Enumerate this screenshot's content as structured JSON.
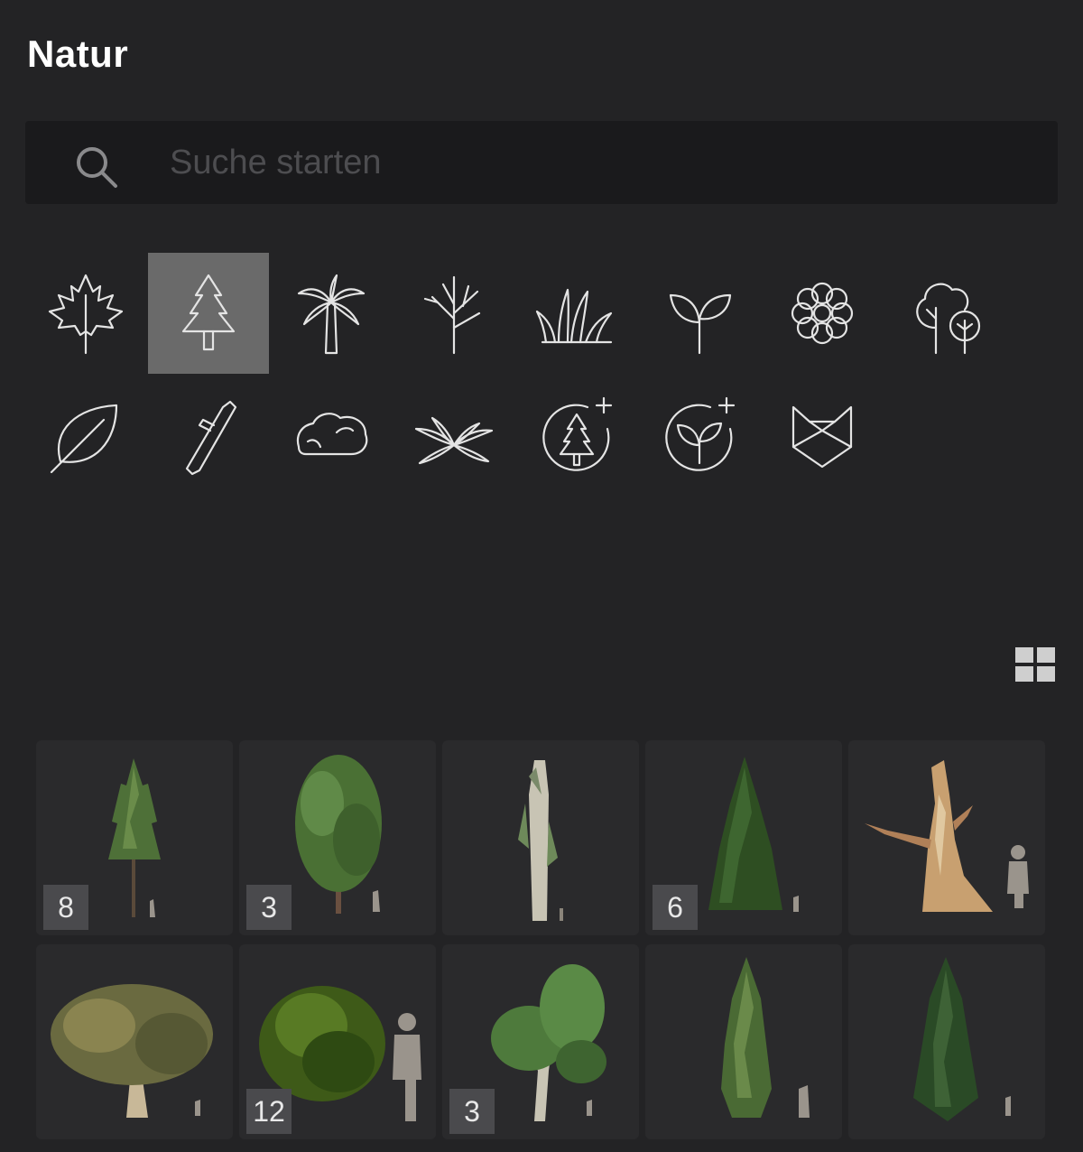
{
  "panel": {
    "title": "Natur"
  },
  "search": {
    "placeholder": "Suche starten",
    "value": ""
  },
  "categories": [
    {
      "icon": "maple-leaf-icon",
      "selected": false
    },
    {
      "icon": "conifer-tree-icon",
      "selected": true
    },
    {
      "icon": "palm-tree-icon",
      "selected": false
    },
    {
      "icon": "bare-tree-icon",
      "selected": false
    },
    {
      "icon": "grass-icon",
      "selected": false
    },
    {
      "icon": "sprout-icon",
      "selected": false
    },
    {
      "icon": "flower-icon",
      "selected": false
    },
    {
      "icon": "tree-group-icon",
      "selected": false
    },
    {
      "icon": "leaf-icon",
      "selected": false
    },
    {
      "icon": "branch-icon",
      "selected": false
    },
    {
      "icon": "rock-icon",
      "selected": false
    },
    {
      "icon": "ground-plants-icon",
      "selected": false
    },
    {
      "icon": "add-tree-icon",
      "selected": false
    },
    {
      "icon": "add-plant-icon",
      "selected": false
    },
    {
      "icon": "fox-icon",
      "selected": false
    }
  ],
  "view_toggle": {
    "icon": "grid-view-icon"
  },
  "assets": [
    {
      "badge": "8",
      "kind": "slim-pine"
    },
    {
      "badge": "3",
      "kind": "leafy-tree"
    },
    {
      "badge": "",
      "kind": "dead-tree"
    },
    {
      "badge": "6",
      "kind": "spruce"
    },
    {
      "badge": "",
      "kind": "gnarled-trunk"
    },
    {
      "badge": "",
      "kind": "wide-oak"
    },
    {
      "badge": "12",
      "kind": "bush"
    },
    {
      "badge": "3",
      "kind": "young-tree"
    },
    {
      "badge": "",
      "kind": "tall-conifer"
    },
    {
      "badge": "",
      "kind": "dark-conifer"
    }
  ],
  "colors": {
    "background": "#232325",
    "search_bg": "#1a1a1c",
    "selected_bg": "#6a6a6a",
    "tile_bg": "#2a2a2c",
    "icon_stroke": "#e4e4e4"
  }
}
